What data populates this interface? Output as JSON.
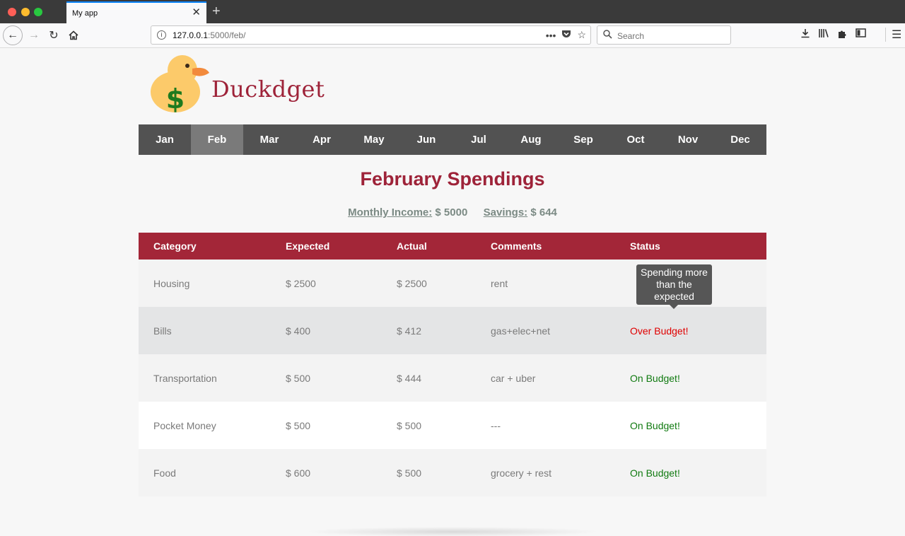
{
  "browser": {
    "tab_title": "My app",
    "url_host": "127.0.0.1",
    "url_rest": ":5000/feb/",
    "search_placeholder": "Search"
  },
  "app": {
    "brand": "Duckdget"
  },
  "months": [
    "Jan",
    "Feb",
    "Mar",
    "Apr",
    "May",
    "Jun",
    "Jul",
    "Aug",
    "Sep",
    "Oct",
    "Nov",
    "Dec"
  ],
  "active_month": "Feb",
  "page": {
    "title": "February Spendings",
    "income_label": "Monthly Income:",
    "income_value": "$ 5000",
    "savings_label": "Savings:",
    "savings_value": "$ 644"
  },
  "table": {
    "headers": [
      "Category",
      "Expected",
      "Actual",
      "Comments",
      "Status"
    ],
    "rows": [
      {
        "category": "Housing",
        "expected": "$ 2500",
        "actual": "$ 2500",
        "comment": "rent",
        "status": ""
      },
      {
        "category": "Bills",
        "expected": "$ 400",
        "actual": "$ 412",
        "comment": "gas+elec+net",
        "status": "Over Budget!"
      },
      {
        "category": "Transportation",
        "expected": "$ 500",
        "actual": "$ 444",
        "comment": "car + uber",
        "status": "On Budget!"
      },
      {
        "category": "Pocket Money",
        "expected": "$ 500",
        "actual": "$ 500",
        "comment": "---",
        "status": "On Budget!"
      },
      {
        "category": "Food",
        "expected": "$ 600",
        "actual": "$ 500",
        "comment": "grocery + rest",
        "status": "On Budget!"
      }
    ]
  },
  "tooltip": {
    "line1": "Spending more",
    "line2": "than the",
    "line3": "expected"
  },
  "colors": {
    "brand": "#9e2339",
    "header_bg": "#a32638",
    "nav_bg": "#525252",
    "over_budget": "#e00000",
    "on_budget": "#107a10"
  }
}
